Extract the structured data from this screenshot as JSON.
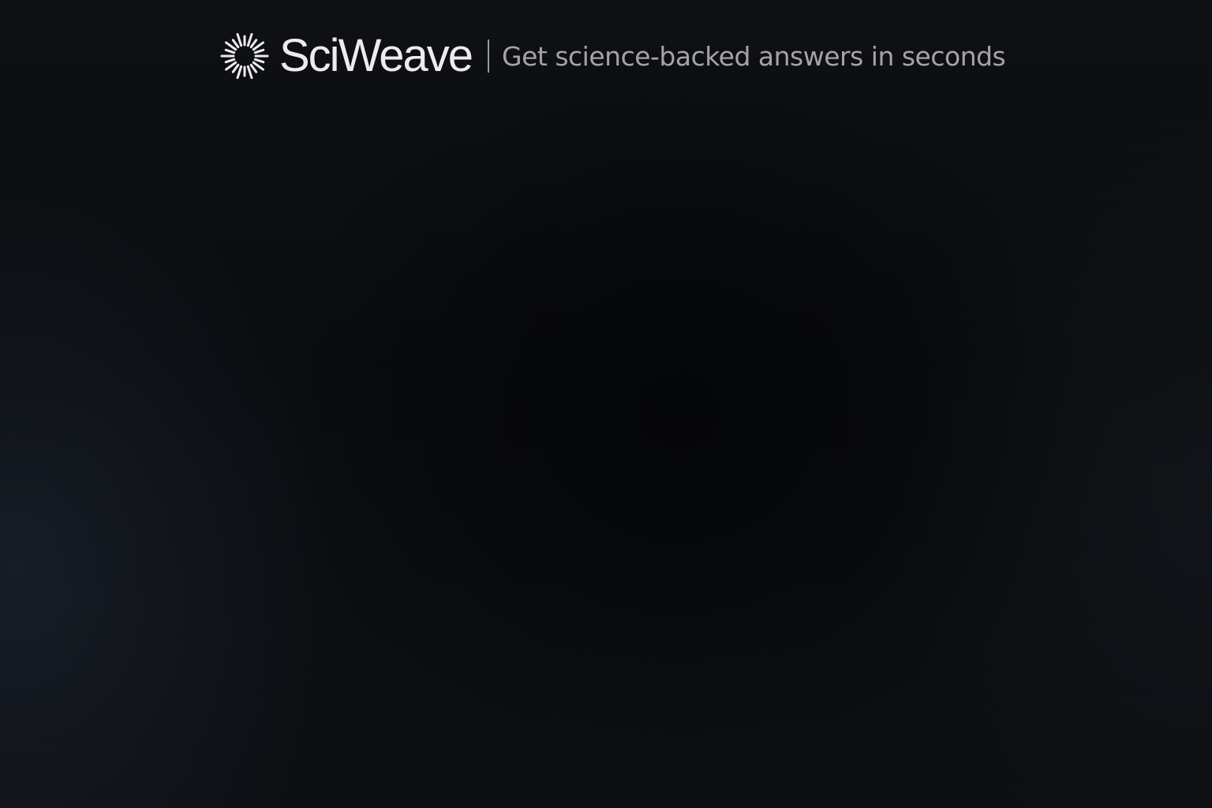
{
  "header": {
    "logo_icon": "sunburst-logo-icon",
    "brand_name": "SciWeave",
    "tagline": "Get science-backed answers in seconds"
  },
  "colors": {
    "background": "#0b0d11",
    "brand_text": "#ececf0",
    "tagline_text": "#a3a3a8",
    "divider": "#9a9a9f"
  }
}
